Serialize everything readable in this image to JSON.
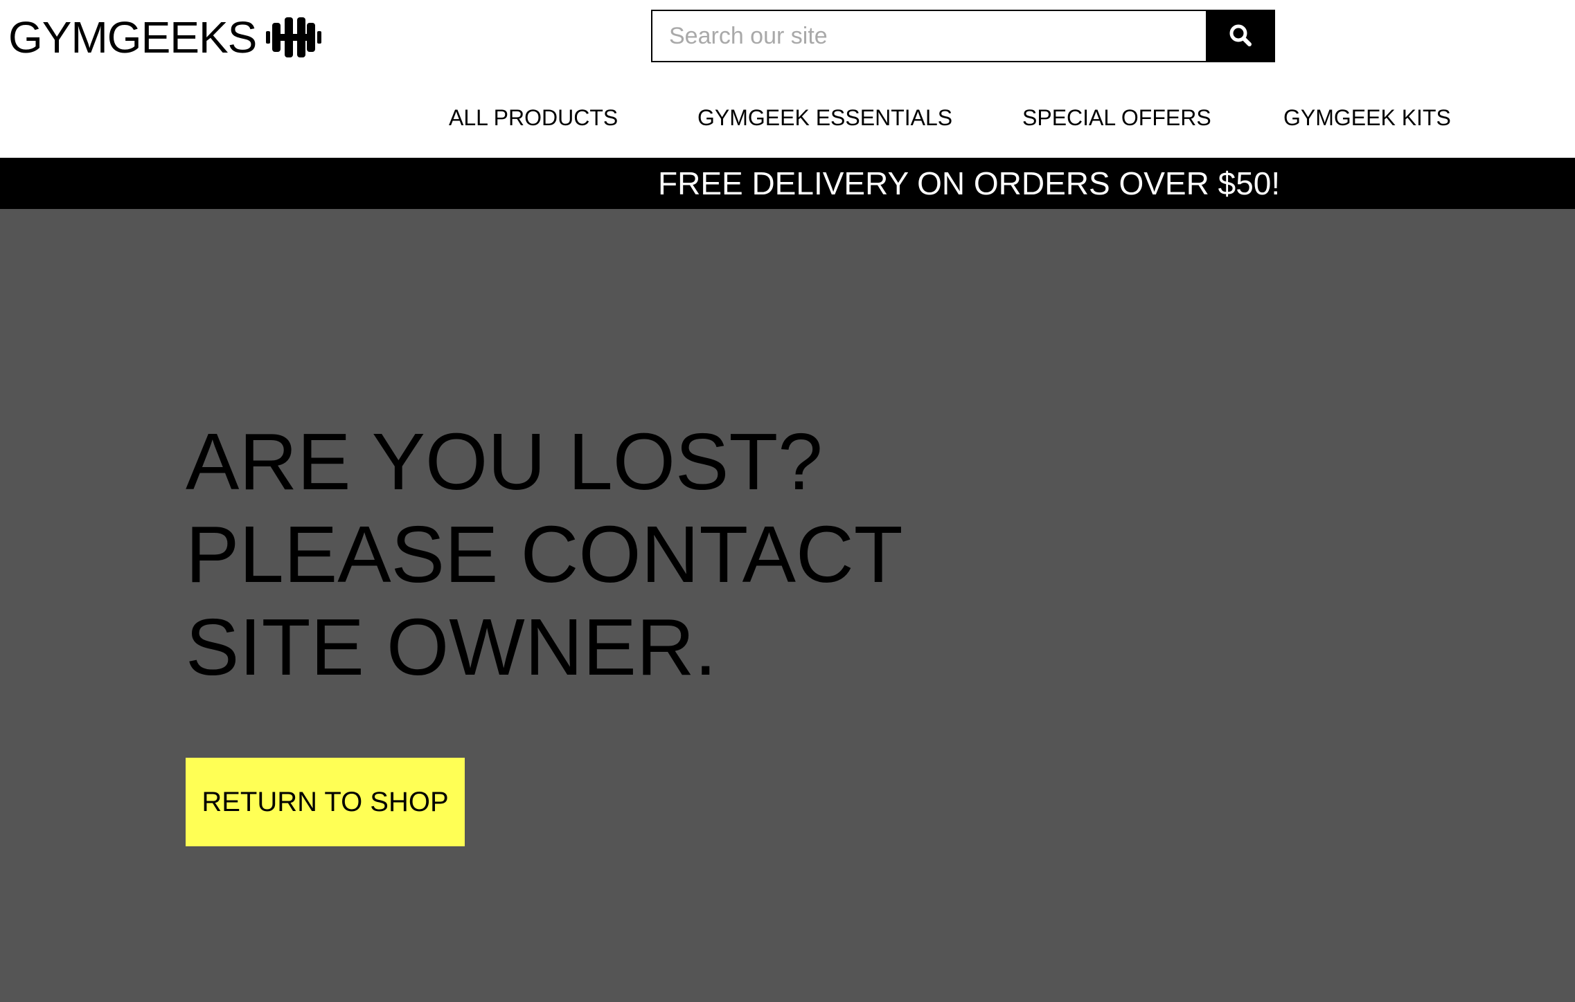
{
  "header": {
    "logo_text": "GYMGEEKS",
    "logo_icon": "dumbbell-icon",
    "search": {
      "placeholder": "Search our site",
      "button_icon": "search-icon"
    },
    "nav": {
      "items": [
        {
          "label": "ALL PRODUCTS"
        },
        {
          "label": "GYMGEEK ESSENTIALS"
        },
        {
          "label": "SPECIAL OFFERS"
        },
        {
          "label": "GYMGEEK KITS"
        }
      ]
    }
  },
  "promo": {
    "text": "FREE DELIVERY ON ORDERS OVER $50!"
  },
  "main": {
    "headline_lines": [
      "ARE YOU LOST?",
      "PLEASE CONTACT",
      "SITE OWNER."
    ],
    "return_button_label": "RETURN TO SHOP"
  },
  "colors": {
    "page_background": "#555555",
    "header_background": "#ffffff",
    "promo_background": "#000000",
    "promo_text": "#ffffff",
    "button_accent": "#ffff55"
  }
}
